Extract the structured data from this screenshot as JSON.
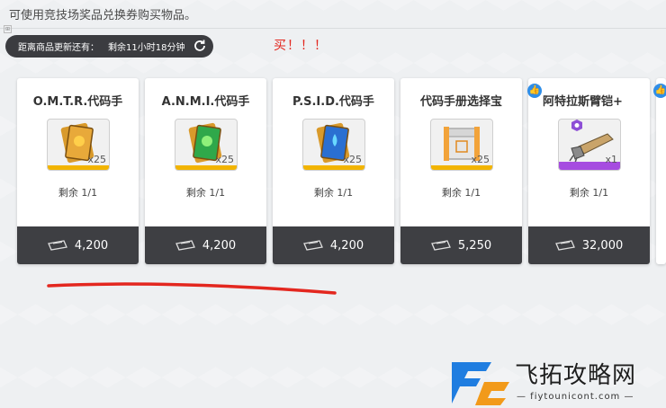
{
  "header": {
    "hint": "可使用竞技场奖品兑换券购买物品。"
  },
  "refresh": {
    "label": "距离商品更新还有：",
    "timer": "剩余11小时18分钟",
    "icon": "refresh-icon"
  },
  "annotation": {
    "text": "买！！！",
    "color": "#e3271f"
  },
  "items": [
    {
      "name": "O.M.T.R.代码手",
      "qty": "x25",
      "remain": "剩余 1/1",
      "price": "4,200",
      "icon": "code-manual-orange-icon",
      "rarity": "gold"
    },
    {
      "name": "A.N.M.I.代码手",
      "qty": "x25",
      "remain": "剩余 1/1",
      "price": "4,200",
      "icon": "code-manual-green-icon",
      "rarity": "gold"
    },
    {
      "name": "P.S.I.D.代码手",
      "qty": "x25",
      "remain": "剩余 1/1",
      "price": "4,200",
      "icon": "code-manual-blue-icon",
      "rarity": "gold"
    },
    {
      "name": "代码手册选择宝",
      "qty": "x25",
      "remain": "剩余 1/1",
      "price": "5,250",
      "icon": "selection-box-icon",
      "rarity": "gold"
    },
    {
      "name": "阿特拉斯臂铠+",
      "qty": "x1",
      "remain": "剩余 1/1",
      "price": "32,000",
      "icon": "arm-gear-icon",
      "rarity": "purple"
    }
  ],
  "watermark": {
    "title": "飞拓攻略网",
    "url": "— fiytounicont.com —"
  },
  "colors": {
    "card_bg": "#ffffff",
    "price_bar": "#3e3f43",
    "gold": "#f2b400",
    "purple": "#a64ce0",
    "badge_blue": "#2f8ee8"
  }
}
